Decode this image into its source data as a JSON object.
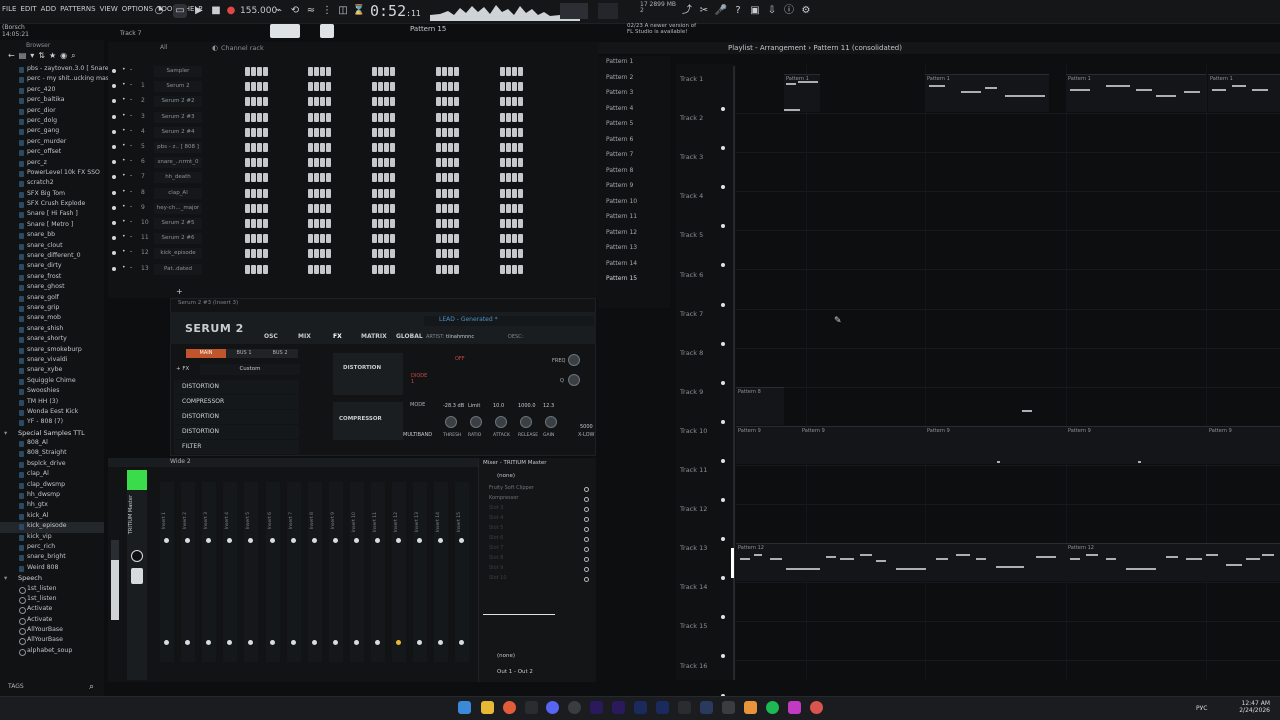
{
  "menu": [
    "FILE",
    "EDIT",
    "ADD",
    "PATTERNS",
    "VIEW",
    "OPTIONS",
    "TOOLS",
    "HELP"
  ],
  "hint": {
    "line1": "(Borsch",
    "line2": "14:05:21"
  },
  "transport": {
    "tempo": "155.000",
    "time": "0:52",
    "time_small": "11",
    "pattern": "Pattern 15"
  },
  "cpu": {
    "line1": "17   2899 MB",
    "line2": "2"
  },
  "news": {
    "line1": "02/23  A newer version of",
    "line2": "FL Studio is available!"
  },
  "toolbar_track": "Track 7",
  "browser": {
    "title": "Browser",
    "items_top": [
      "pbs - zaytoven.3.0 [ Snare ]",
      "perc - my shit..ucking masive",
      "perc_420",
      "perc_baltika",
      "perc_dior",
      "perc_dolg",
      "perc_gang",
      "perc_murder",
      "perc_offset",
      "perc_z",
      "PowerLevel 10k FX SSO",
      "scratch2",
      "SFX Big Tom",
      "SFX Crush Explode",
      "Snare [ Hi Fash ]",
      "Snare [ Metro ]",
      "snare_bb",
      "snare_clout",
      "snare_different_0",
      "snare_dirty",
      "snare_frost",
      "snare_ghost",
      "snare_golf",
      "snare_grip",
      "snare_mob",
      "snare_shish",
      "snare_shorty",
      "snare_smokeburp",
      "snare_vivaldi",
      "snare_xybe",
      "Squiggle Chime",
      "Swooshies",
      "TM HH (3)",
      "Wonda Eest Kick",
      "YF - 808 (7)"
    ],
    "folder_special": "Special Samples TTL",
    "items_special": [
      "808_Al",
      "808_Straight",
      "bsplck_drive",
      "clap_Al",
      "clap_dwsmp",
      "hh_dwsmp",
      "hh_gtx",
      "kick_Al",
      "kick_episode",
      "kick_vip",
      "perc_rich",
      "snare_bright",
      "Weird 808"
    ],
    "folder_speech": "Speech",
    "items_speech": [
      "1st_listen",
      "1st_listen",
      "Activate",
      "Activate",
      "AllYourBase",
      "AllYourBase",
      "alphabet_soup"
    ],
    "tags": "TAGS"
  },
  "channel_rack": {
    "title": "Channel rack",
    "filter": "All",
    "channels": [
      {
        "num": "",
        "name": "Sampler"
      },
      {
        "num": "1",
        "name": "Serum 2"
      },
      {
        "num": "2",
        "name": "Serum 2 #2"
      },
      {
        "num": "3",
        "name": "Serum 2 #3"
      },
      {
        "num": "4",
        "name": "Serum 2 #4"
      },
      {
        "num": "5",
        "name": "pbs - z.. [ 808 ]"
      },
      {
        "num": "6",
        "name": "snare_..nrmt_0"
      },
      {
        "num": "7",
        "name": "hh_death"
      },
      {
        "num": "8",
        "name": "clap_Al"
      },
      {
        "num": "9",
        "name": "hey-ch..._major"
      },
      {
        "num": "10",
        "name": "Serum 2 #5"
      },
      {
        "num": "11",
        "name": "Serum 2 #6"
      },
      {
        "num": "12",
        "name": "kick_episode"
      },
      {
        "num": "13",
        "name": "Pat..dated"
      }
    ]
  },
  "serum": {
    "window_title": "Serum 2 #3 (Insert 3)",
    "logo": "SERUM 2",
    "tabs": [
      "OSC",
      "MIX",
      "FX",
      "MATRIX",
      "GLOBAL"
    ],
    "preset": "LEAD - Generated *",
    "artist_label": "ARTIST:",
    "artist": "tiinahmnnc",
    "desc_label": "DESC:",
    "bus_tabs": [
      "MAIN",
      "BUS 1",
      "BUS 2"
    ],
    "fx_label": "+ FX",
    "fx_preset": "Custom",
    "fx_chain": [
      "DISTORTION",
      "COMPRESSOR",
      "DISTORTION",
      "DISTORTION",
      "FILTER"
    ],
    "distortion_label": "DISTORTION",
    "compressor_label": "COMPRESSOR",
    "mode_label": "MODE",
    "mode_value": "DIODE 1",
    "comp_params": [
      "THRESH",
      "RATIO",
      "ATTACK",
      "RELEASE",
      "GAIN"
    ],
    "comp_values": [
      "-28.3 dB",
      "Limit",
      "10.0",
      "1000.0",
      "12.3"
    ],
    "comp_mode": "MULTIBAND",
    "freq_label": "FREQ",
    "q_label": "Q",
    "off_label": "OFF",
    "xlow_value": "5000",
    "xlow_label": "X-LOW"
  },
  "mixer": {
    "title": "Mixer - TRITIUM Master",
    "view": "Wide 2",
    "master": "TRITIUM Master",
    "inserts": [
      "Insert 1",
      "Insert 2",
      "Insert 3",
      "Insert 4",
      "Insert 5",
      "Insert 6",
      "Insert 7",
      "Insert 8",
      "Insert 9",
      "Insert 10",
      "Insert 11",
      "Insert 12",
      "Insert 13",
      "Insert 14",
      "Insert 15"
    ],
    "slots_top": "(none)",
    "slots": [
      "Fruity Soft Clipper",
      "Kompressor",
      "Slot 3",
      "Slot 4",
      "Slot 5",
      "Slot 6",
      "Slot 7",
      "Slot 8",
      "Slot 9",
      "Slot 10"
    ],
    "slot_bottom": "(none)",
    "output": "Out 1 - Out 2"
  },
  "patterns": [
    "Pattern 1",
    "Pattern 2",
    "Pattern 3",
    "Pattern 4",
    "Pattern 5",
    "Pattern 6",
    "Pattern 7",
    "Pattern 8",
    "Pattern 9",
    "Pattern 10",
    "Pattern 11",
    "Pattern 12",
    "Pattern 13",
    "Pattern 14",
    "Pattern 15"
  ],
  "playlist": {
    "title": "Playlist - Arrangement",
    "sep": "›",
    "pattern": "Pattern 11 (consolidated)",
    "tracks": [
      "Track 1",
      "Track 2",
      "Track 3",
      "Track 4",
      "Track 5",
      "Track 6",
      "Track 7",
      "Track 8",
      "Track 9",
      "Track 10",
      "Track 11",
      "Track 12",
      "Track 13",
      "Track 14",
      "Track 15",
      "Track 16"
    ],
    "clip_labels": [
      "Pattern 1",
      "Pattern 8",
      "Pattern 9",
      "Pattern 12"
    ]
  },
  "taskbar": {
    "lang": "РУС",
    "time": "12:47 AM",
    "date": "2/24/2026"
  }
}
